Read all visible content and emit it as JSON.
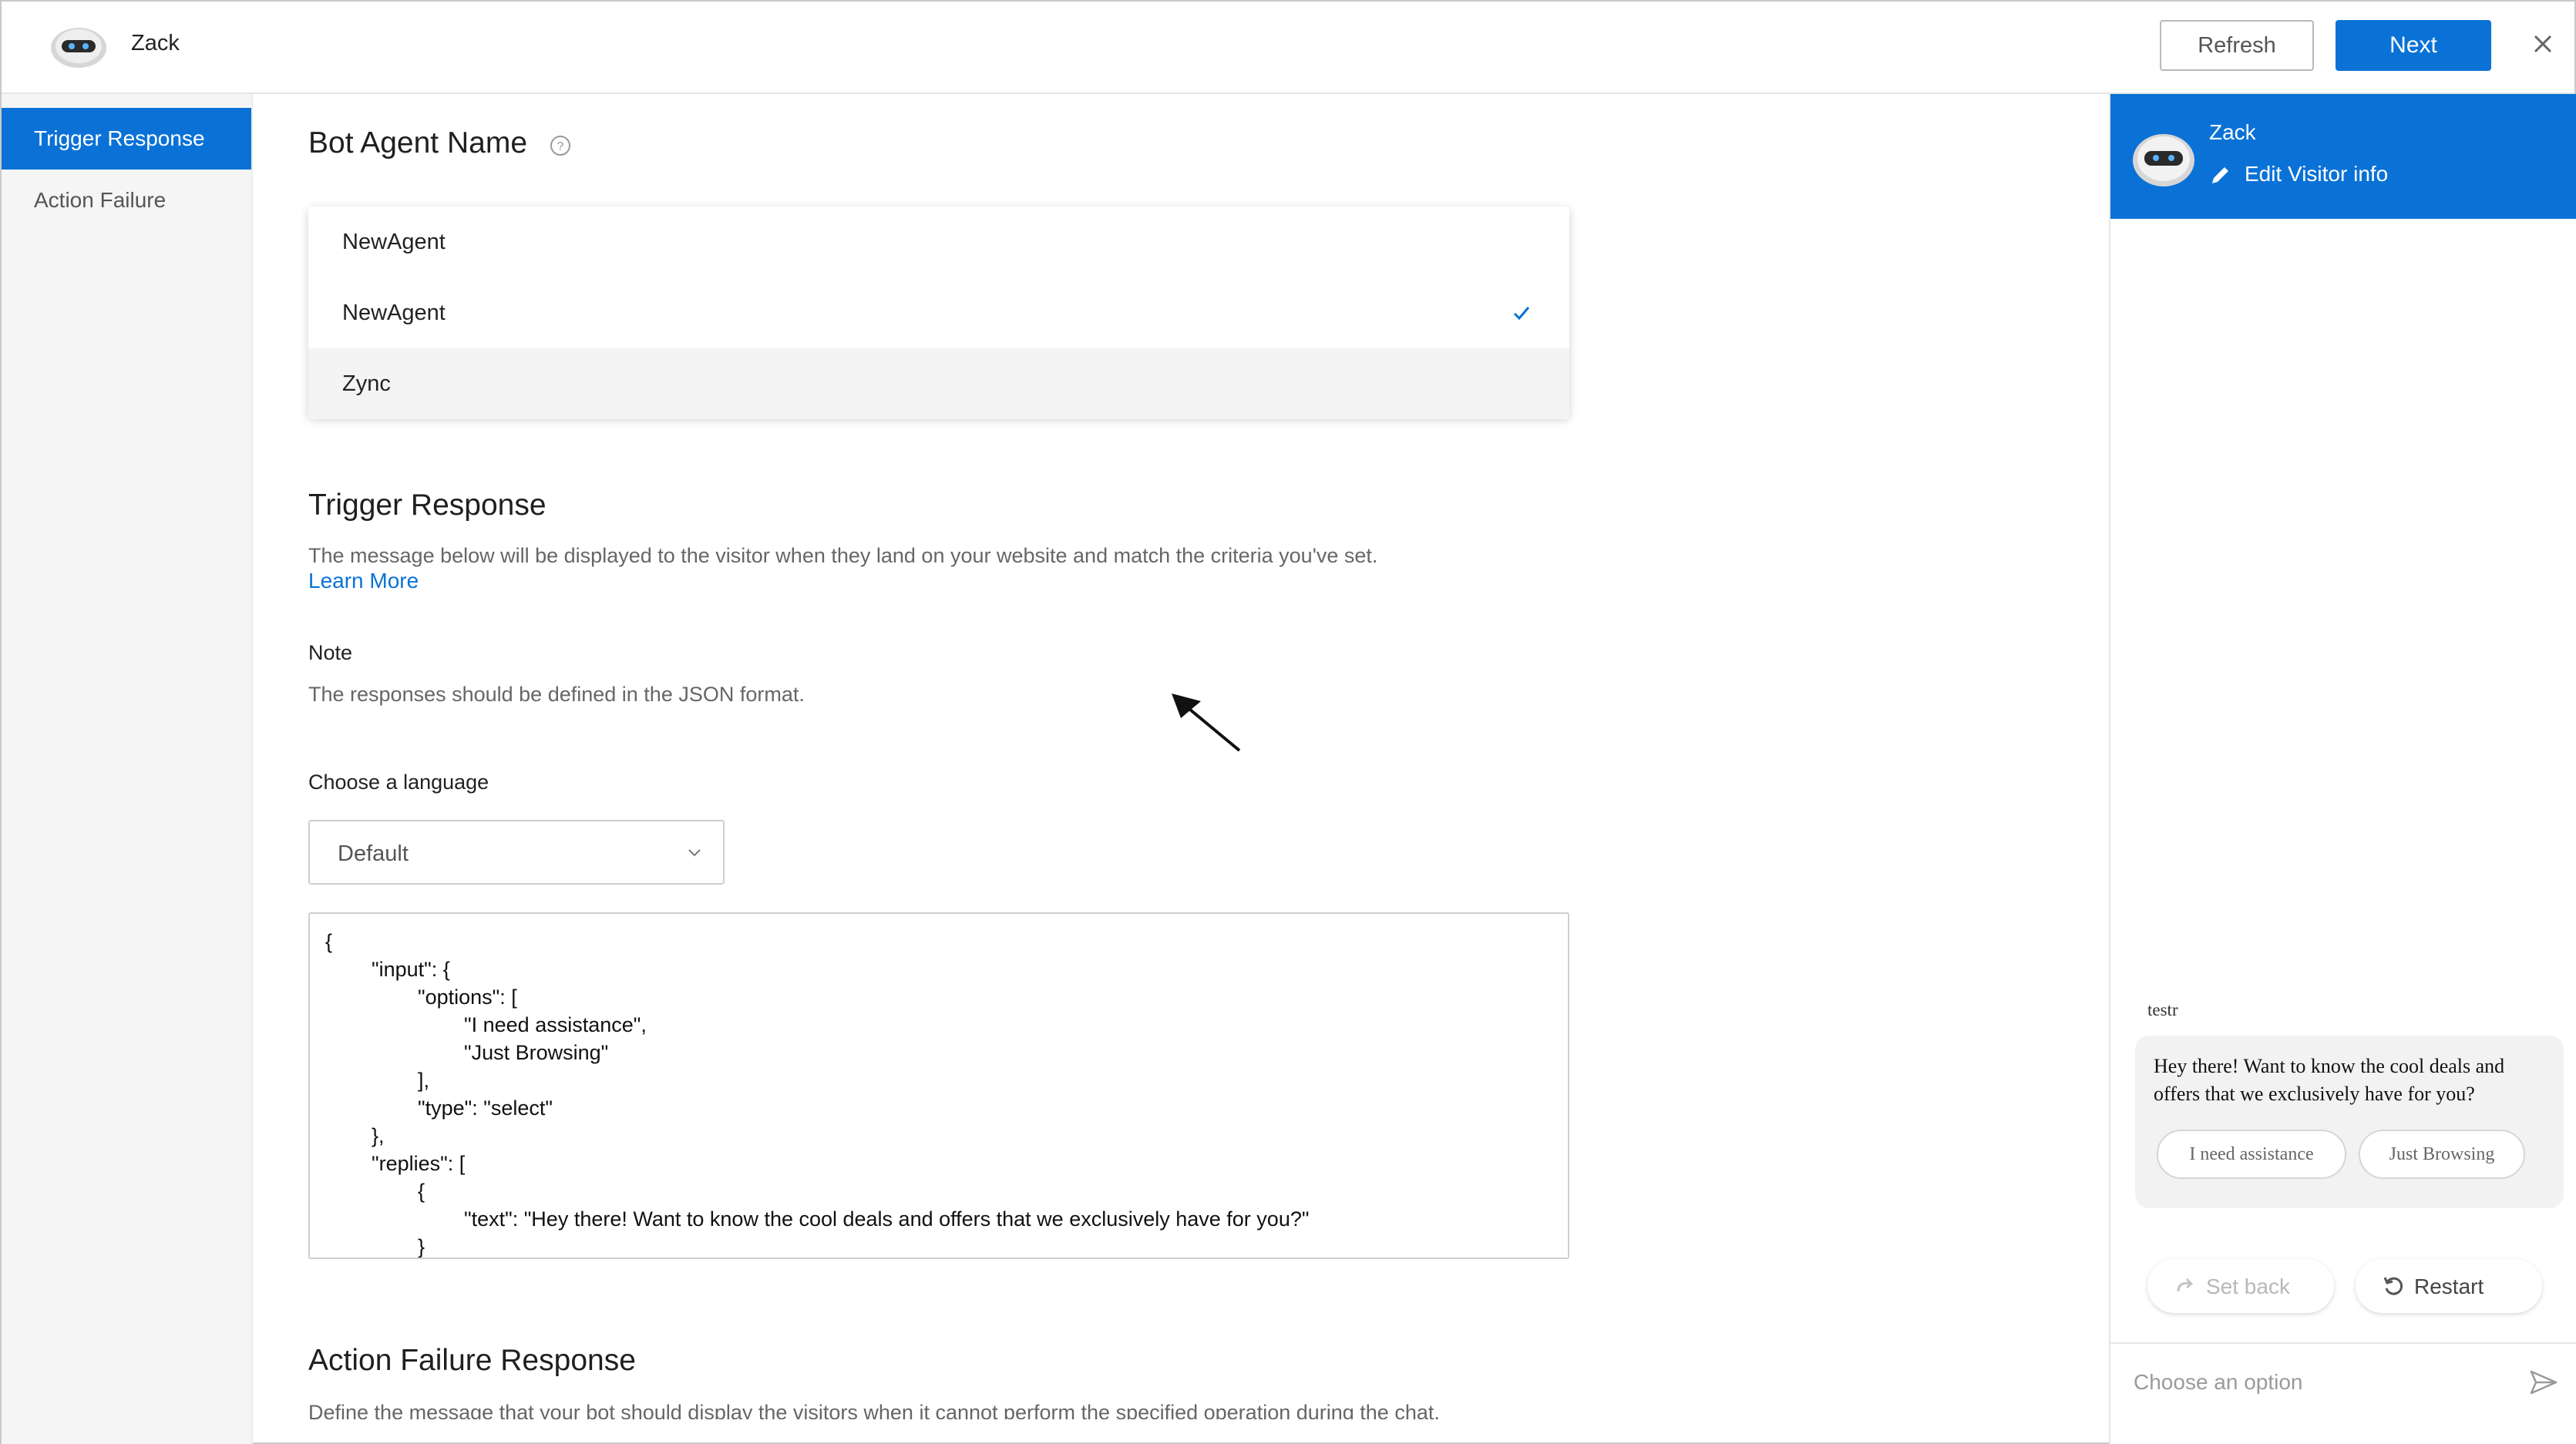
{
  "header": {
    "bot_name": "Zack",
    "refresh_label": "Refresh",
    "next_label": "Next"
  },
  "sidebar": {
    "items": [
      {
        "label": "Trigger Response",
        "active": true
      },
      {
        "label": "Action Failure",
        "active": false
      }
    ]
  },
  "main": {
    "bot_agent_name_title": "Bot Agent Name",
    "agent_options": [
      {
        "label": "NewAgent",
        "selected": false
      },
      {
        "label": "NewAgent",
        "selected": true
      },
      {
        "label": "Zync",
        "selected": false
      }
    ],
    "trigger_title": "Trigger Response",
    "trigger_desc": "The message below will be displayed to the visitor when they land on your website and match the criteria you've set.",
    "learn_more": "Learn More",
    "note_label": "Note",
    "note_text": "The responses should be defined in the JSON format.",
    "language_label": "Choose a language",
    "language_value": "Default",
    "json_code": "{\n        \"input\": {\n                \"options\": [\n                        \"I need assistance\",\n                        \"Just Browsing\"\n                ],\n                \"type\": \"select\"\n        },\n        \"replies\": [\n                {\n                        \"text\": \"Hey there! Want to know the cool deals and offers that we exclusively have for you?\"\n                }",
    "action_failure_title": "Action Failure Response",
    "action_failure_desc": "Define the message that your bot should display the visitors when it cannot perform the specified operation during the chat."
  },
  "chat": {
    "bot_name": "Zack",
    "edit_label": "Edit Visitor info",
    "sender": "testr",
    "message": "Hey there! Want to know the cool deals and offers that we exclusively have for you?",
    "options": [
      "I need assistance",
      "Just Browsing"
    ],
    "setback_label": "Set back",
    "restart_label": "Restart",
    "input_placeholder": "Choose an option"
  },
  "colors": {
    "accent": "#0a72d6",
    "sidebar_bg": "#f5f5f5",
    "bubble_bg": "#f2f2f2"
  },
  "icons": [
    "bot-avatar-icon",
    "help-circle-icon",
    "check-icon",
    "chevron-down-icon",
    "close-icon",
    "pencil-icon",
    "redo-icon",
    "restart-icon",
    "send-icon",
    "cursor-arrow-icon"
  ]
}
